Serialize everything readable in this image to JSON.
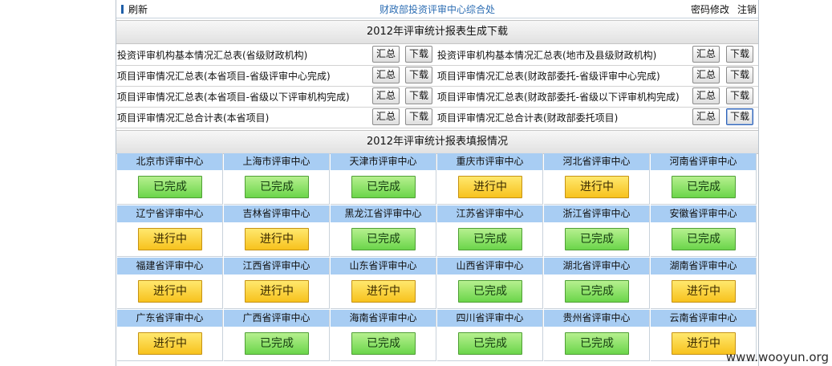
{
  "topbar": {
    "refresh_label": "刷新",
    "title": "财政部投资评审中心综合处",
    "change_password": "密码修改",
    "logout": "注销"
  },
  "download_section": {
    "title": "2012年评审统计报表生成下载",
    "summary_label": "汇总",
    "download_label": "下载",
    "rows": [
      {
        "left": "投资评审机构基本情况汇总表(省级财政机构)",
        "right": "投资评审机构基本情况汇总表(地市及县级财政机构)"
      },
      {
        "left": "项目评审情况汇总表(本省项目-省级评审中心完成)",
        "right": "项目评审情况汇总表(财政部委托-省级评审中心完成)"
      },
      {
        "left": "项目评审情况汇总表(本省项目-省级以下评审机构完成)",
        "right": "项目评审情况汇总表(财政部委托-省级以下评审机构完成)"
      },
      {
        "left": "项目评审情况汇总合计表(本省项目)",
        "right": "项目评审情况汇总合计表(财政部委托项目)"
      }
    ]
  },
  "fill_section": {
    "title": "2012年评审统计报表填报情况",
    "status_labels": {
      "done": "已完成",
      "prog": "进行中"
    },
    "colors": {
      "header_bg": "#a8cdf3",
      "done": "#6bd54a",
      "in_progress": "#f7c21d"
    },
    "centers": [
      {
        "name": "北京市评审中心",
        "status": "已完成"
      },
      {
        "name": "上海市评审中心",
        "status": "已完成"
      },
      {
        "name": "天津市评审中心",
        "status": "已完成"
      },
      {
        "name": "重庆市评审中心",
        "status": "进行中"
      },
      {
        "name": "河北省评审中心",
        "status": "进行中"
      },
      {
        "name": "河南省评审中心",
        "status": "已完成"
      },
      {
        "name": "辽宁省评审中心",
        "status": "进行中"
      },
      {
        "name": "吉林省评审中心",
        "status": "进行中"
      },
      {
        "name": "黑龙江省评审中心",
        "status": "已完成"
      },
      {
        "name": "江苏省评审中心",
        "status": "已完成"
      },
      {
        "name": "浙江省评审中心",
        "status": "已完成"
      },
      {
        "name": "安徽省评审中心",
        "status": "已完成"
      },
      {
        "name": "福建省评审中心",
        "status": "进行中"
      },
      {
        "name": "江西省评审中心",
        "status": "进行中"
      },
      {
        "name": "山东省评审中心",
        "status": "进行中"
      },
      {
        "name": "山西省评审中心",
        "status": "已完成"
      },
      {
        "name": "湖北省评审中心",
        "status": "已完成"
      },
      {
        "name": "湖南省评审中心",
        "status": "进行中"
      },
      {
        "name": "广东省评审中心",
        "status": "进行中"
      },
      {
        "name": "广西省评审中心",
        "status": "已完成"
      },
      {
        "name": "海南省评审中心",
        "status": "已完成"
      },
      {
        "name": "四川省评审中心",
        "status": "已完成"
      },
      {
        "name": "贵州省评审中心",
        "status": "已完成"
      },
      {
        "name": "云南省评审中心",
        "status": "进行中"
      }
    ]
  },
  "watermark": "www.wooyun.org"
}
